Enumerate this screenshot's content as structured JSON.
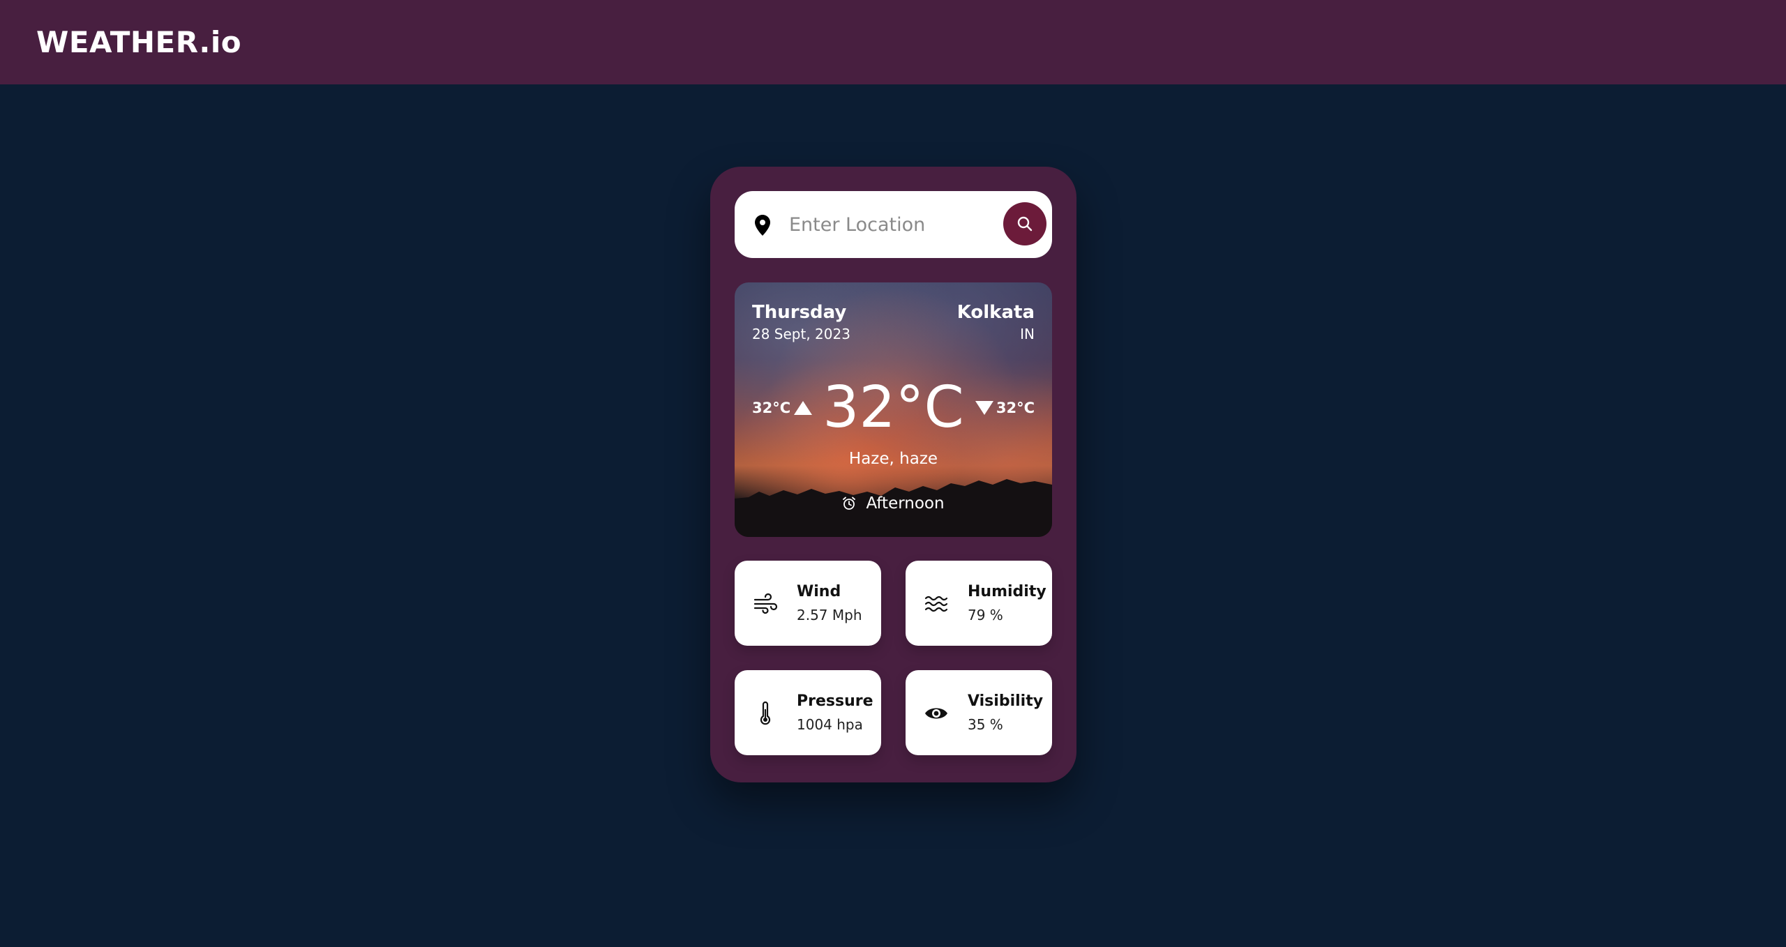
{
  "navbar": {
    "brand": "WEATHER.io"
  },
  "search": {
    "placeholder": "Enter Location",
    "value": ""
  },
  "weather": {
    "day": "Thursday",
    "date": "28 Sept, 2023",
    "city": "Kolkata",
    "country": "IN",
    "temp": "32°C",
    "min_temp": "32°C",
    "max_temp": "32°C",
    "description": "Haze, haze",
    "period": "Afternoon"
  },
  "stats": {
    "wind": {
      "label": "Wind",
      "value": "2.57 Mph"
    },
    "humidity": {
      "label": "Humidity",
      "value": "79 %"
    },
    "pressure": {
      "label": "Pressure",
      "value": "1004 hpa"
    },
    "visibility": {
      "label": "Visibility",
      "value": "35 %"
    }
  },
  "colors": {
    "background": "#0c1d33",
    "accent": "#481f40",
    "search_button": "#6c1b3a"
  },
  "icons": {
    "search": "location-pin-icon",
    "search_button": "search-icon",
    "period": "alarm-clock-icon",
    "wind": "wind-icon",
    "humidity": "waves-icon",
    "pressure": "thermometer-icon",
    "visibility": "eye-icon"
  }
}
